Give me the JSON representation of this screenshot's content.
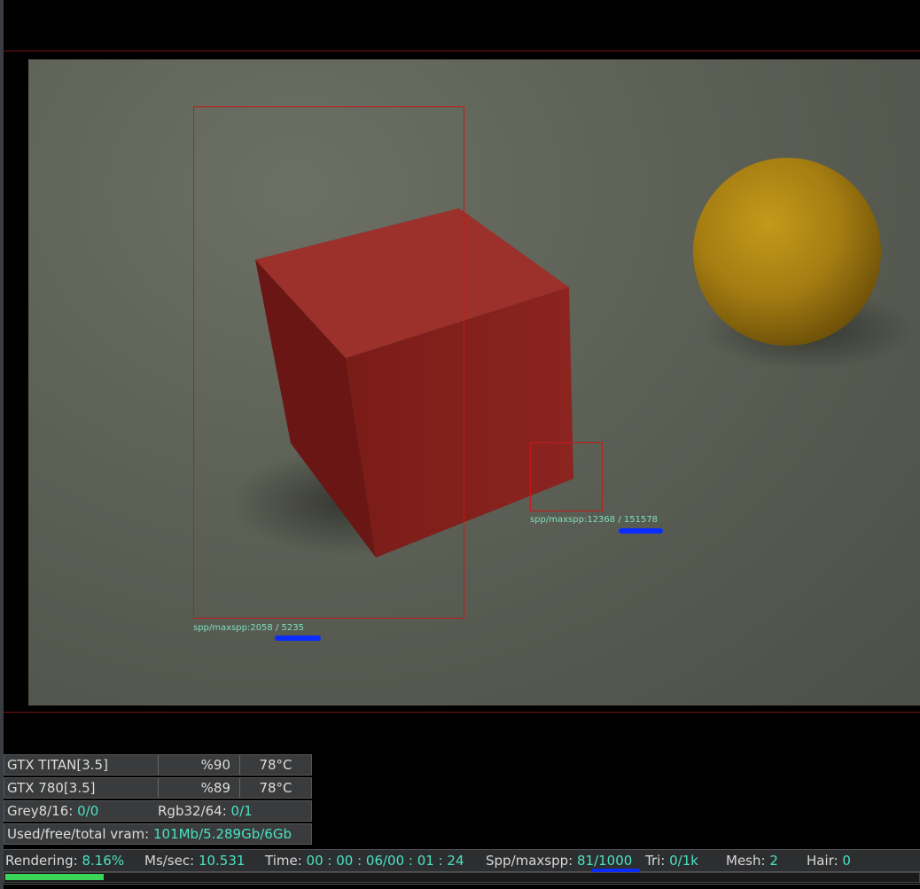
{
  "viewport": {
    "region_large": {
      "label": "spp/maxspp:2058 / 5235"
    },
    "region_small": {
      "label": "spp/maxspp:12368 / 151578"
    }
  },
  "gpus": [
    {
      "name": "GTX TITAN[3.5]",
      "load": "%90",
      "temp": "78°C"
    },
    {
      "name": "GTX 780[3.5]",
      "load": "%89",
      "temp": "78°C"
    }
  ],
  "buffers": {
    "grey_label": "Grey8/16:",
    "grey_value": "0/0",
    "rgb_label": "Rgb32/64:",
    "rgb_value": "0/1"
  },
  "vram": {
    "label": "Used/free/total vram:",
    "value": "101Mb/5.289Gb/6Gb"
  },
  "status": {
    "rendering_label": "Rendering:",
    "rendering_value": "8.16%",
    "mssec_label": "Ms/sec:",
    "mssec_value": "10.531",
    "time_label": "Time:",
    "time_value": "00 : 00 : 06/00 : 01 : 24",
    "spp_label": "Spp/maxspp:",
    "spp_value": "81/1000",
    "tri_label": "Tri:",
    "tri_value": "0/1k",
    "mesh_label": "Mesh:",
    "mesh_value": "2",
    "hair_label": "Hair:",
    "hair_value": "0"
  },
  "progress": {
    "fraction": 0.0816
  },
  "colors": {
    "accent": "#49e3c4",
    "region_border": "#c41a1a",
    "progress": "#3ad65a",
    "marker": "#0a2cff"
  }
}
